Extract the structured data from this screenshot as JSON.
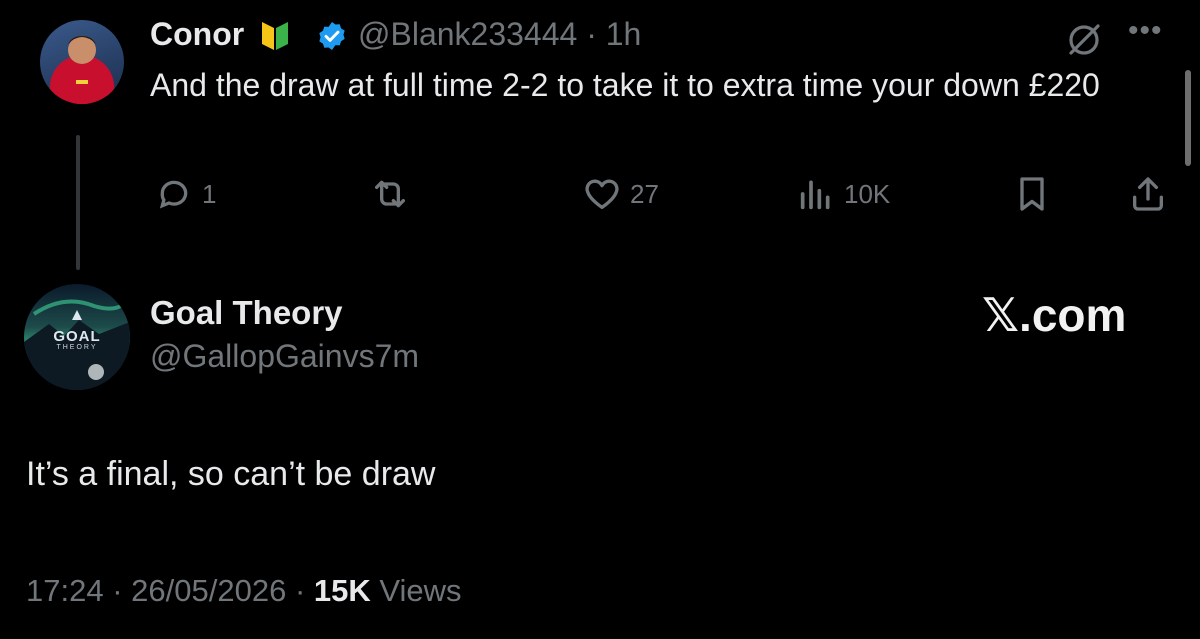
{
  "parent_tweet": {
    "name": "Conor",
    "handle": "@Blank233444",
    "separator": "·",
    "time": "1h",
    "text": "And the draw at full time 2-2 to take it to extra time your down £220",
    "actions": {
      "replies": "1",
      "reposts": "",
      "likes": "27",
      "views": "10K"
    },
    "icons": [
      "beginner-badge-icon",
      "verified-badge-icon",
      "grok-icon",
      "more-icon",
      "reply-icon",
      "repost-icon",
      "like-icon",
      "views-icon",
      "bookmark-icon",
      "share-icon"
    ]
  },
  "main_tweet": {
    "name": "Goal Theory",
    "handle": "@GallopGainvs7m",
    "avatar_logo_text": "GOAL",
    "avatar_logo_subtext": "THEORY",
    "text": "It’s a final, so can’t be draw",
    "time": "17:24",
    "date": "26/05/2026",
    "views_count": "15K",
    "views_label": "Views",
    "separator": "·"
  },
  "watermark": "𝕏.com",
  "colors": {
    "background": "#000000",
    "text_primary": "#e7e9ea",
    "text_secondary": "#71767b",
    "verified_blue": "#1d9bf0",
    "thread_line": "#333639"
  }
}
